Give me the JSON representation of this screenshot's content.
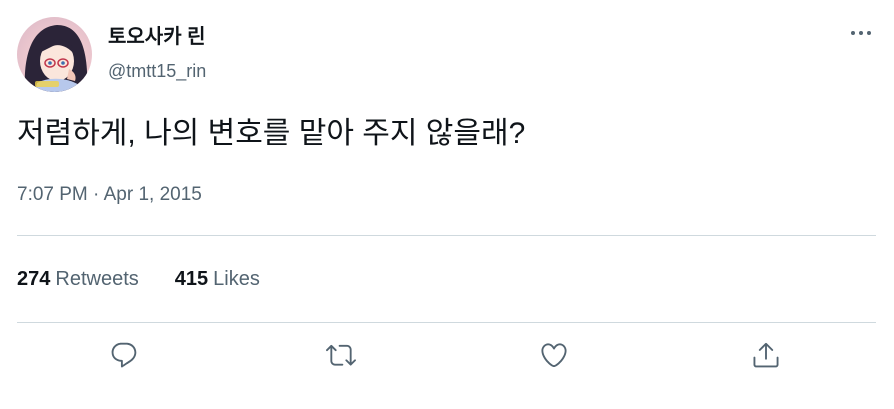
{
  "author": {
    "display_name": "토오사카 린",
    "handle": "@tmtt15_rin",
    "avatar_icon": "anime-girl-avatar"
  },
  "tweet": {
    "text": "저렴하게, 나의 변호를 맡아 주지 않을래?",
    "timestamp": "7:07 PM · Apr 1, 2015"
  },
  "stats": {
    "retweets_count": "274",
    "retweets_label": "Retweets",
    "likes_count": "415",
    "likes_label": "Likes"
  },
  "actions": [
    {
      "icon": "reply-icon"
    },
    {
      "icon": "retweet-icon"
    },
    {
      "icon": "like-icon"
    },
    {
      "icon": "share-icon"
    }
  ],
  "menu_icon": "more-options-icon",
  "colors": {
    "text_primary": "#0f1419",
    "text_secondary": "#536471",
    "divider": "#cfd9de"
  }
}
